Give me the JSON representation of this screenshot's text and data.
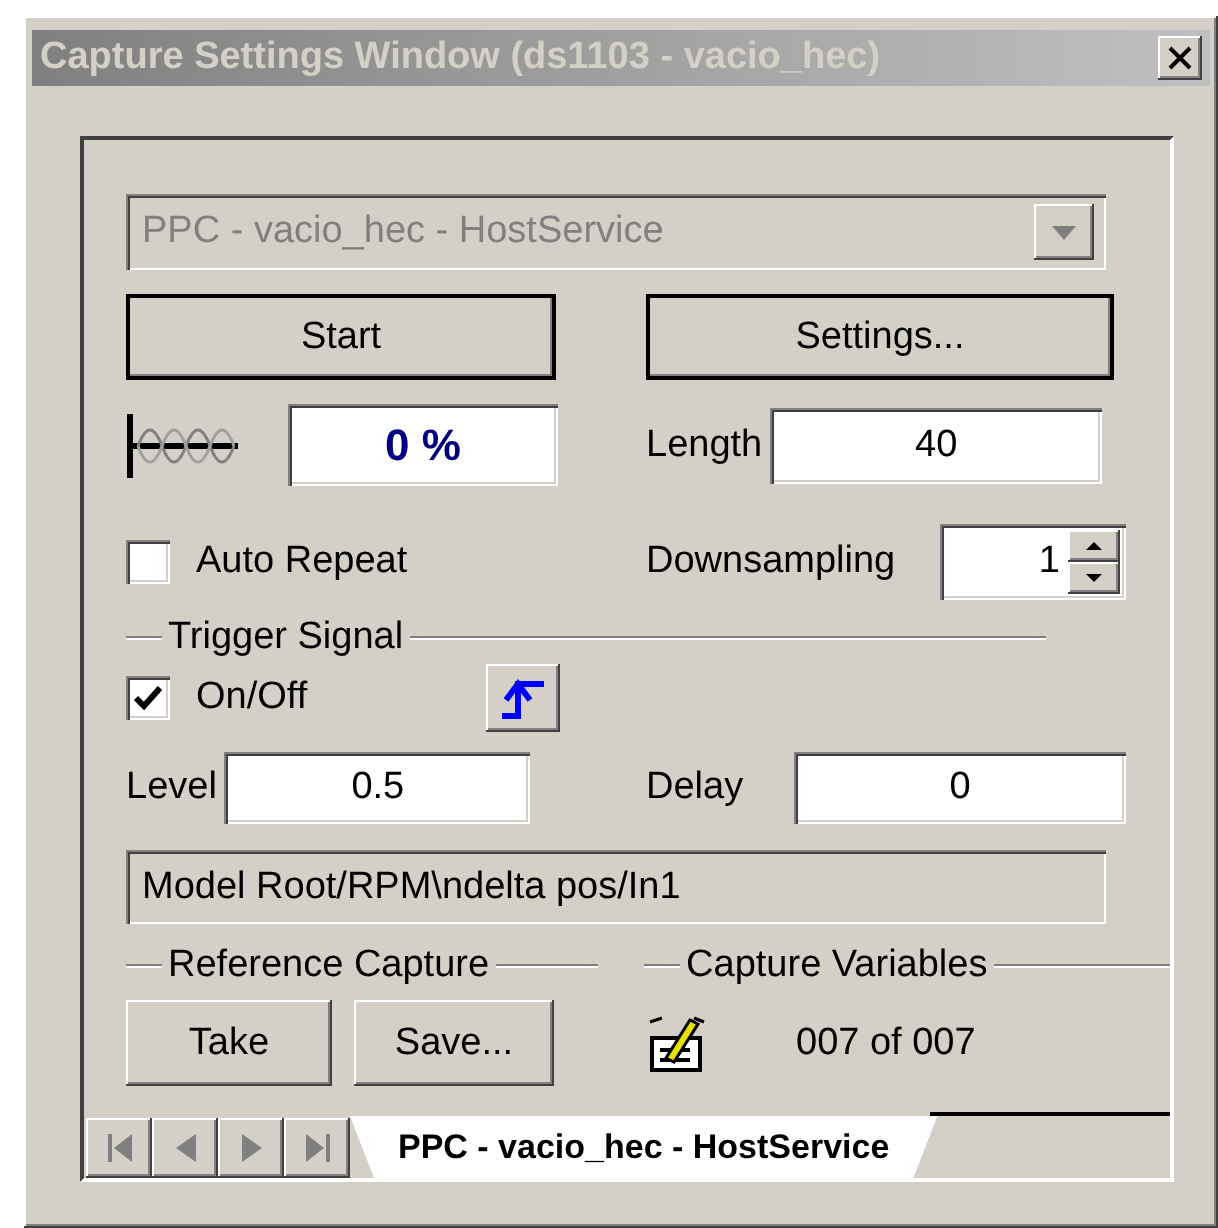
{
  "window": {
    "title": "Capture Settings Window (ds1103 - vacio_hec)"
  },
  "platform_select": {
    "value": "PPC - vacio_hec - HostService",
    "disabled": true
  },
  "start_button": {
    "label": "Start"
  },
  "settings_button": {
    "label": "Settings..."
  },
  "progress": {
    "value": "0 %"
  },
  "length": {
    "label": "Length",
    "value": "40"
  },
  "auto_repeat": {
    "label": "Auto Repeat",
    "checked": false
  },
  "downsampling": {
    "label": "Downsampling",
    "value": "1"
  },
  "trigger": {
    "title": "Trigger Signal",
    "on_off": {
      "label": "On/Off",
      "checked": true
    },
    "level": {
      "label": "Level",
      "value": "0.5"
    },
    "delay": {
      "label": "Delay",
      "value": "0"
    },
    "signal_path": "Model Root/RPM\\ndelta pos/In1"
  },
  "reference_capture": {
    "title": "Reference Capture",
    "buttons": [
      "Take",
      "Save..."
    ]
  },
  "capture_variables": {
    "title": "Capture Variables",
    "count": "007 of 007"
  },
  "tabs": [
    {
      "label": "PPC - vacio_hec - HostService",
      "selected": true
    }
  ]
}
